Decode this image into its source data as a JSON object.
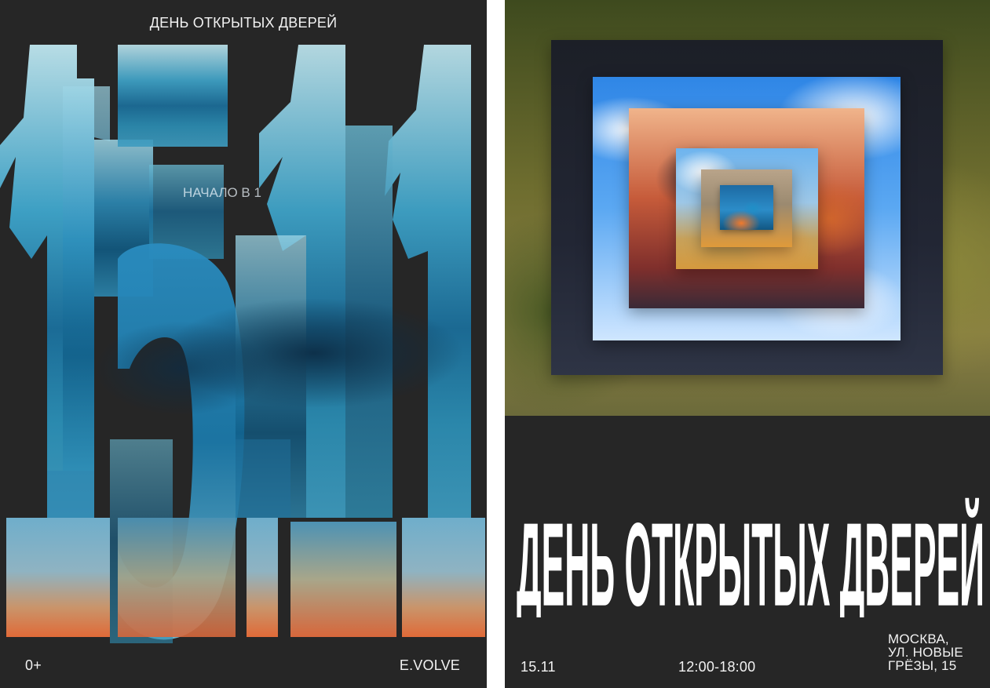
{
  "left_poster": {
    "title": "ДЕНЬ ОТКРЫТЫХ ДВЕРЕЙ",
    "big_date": "15.11",
    "start_text": "НАЧАЛО В 1",
    "age_rating": "0+",
    "brand": "E.VOLVE"
  },
  "right_poster": {
    "big_title": "ДЕНЬ ОТКРЫТЫХ ДВЕРЕЙ",
    "date": "15.11",
    "time": "12:00-18:00",
    "address_line1": "МОСКВА,",
    "address_line2": "УЛ. НОВЫЕ",
    "address_line3": "ГРЁЗЫ, 15"
  },
  "colors": {
    "poster_bg": "#262626",
    "text": "#f2f2f2",
    "accent_blue": "#1e7fb3",
    "accent_orange": "#e0733a"
  }
}
